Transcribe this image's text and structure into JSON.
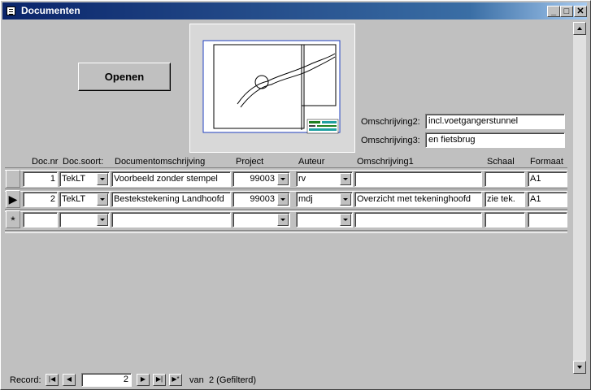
{
  "window": {
    "title": "Documenten",
    "min_label": "_",
    "max_label": "□",
    "close_label": "✕"
  },
  "open_button": {
    "label": "Openen"
  },
  "fields": {
    "omschrijving2": {
      "label": "Omschrijving2:",
      "value": "incl.voetgangerstunnel"
    },
    "omschrijving3": {
      "label": "Omschrijving3:",
      "value": "en fietsbrug"
    }
  },
  "columns": [
    "Doc.nr",
    "Doc.soort:",
    "Documentomschrijving",
    "Project",
    "Auteur",
    "Omschrijving1",
    "Schaal",
    "Formaat"
  ],
  "rows": [
    {
      "docnr": "1",
      "docsoort": "TekLT",
      "omschrijving": "Voorbeeld zonder stempel",
      "project": "99003",
      "auteur": "rv",
      "omschrijving1": "",
      "schaal": "",
      "formaat": "A1",
      "selector": ""
    },
    {
      "docnr": "2",
      "docsoort": "TekLT",
      "omschrijving": "Bestekstekening Landhoofd",
      "project": "99003",
      "auteur": "mdj",
      "omschrijving1": "Overzicht met tekeninghoofd",
      "schaal": "zie tek.",
      "formaat": "A1",
      "selector": "▶"
    }
  ],
  "new_row": {
    "selector": "*"
  },
  "navigation": {
    "record_label": "Record:",
    "current": "2",
    "of_label": "van",
    "total_text": "2 (Gefilterd)"
  }
}
